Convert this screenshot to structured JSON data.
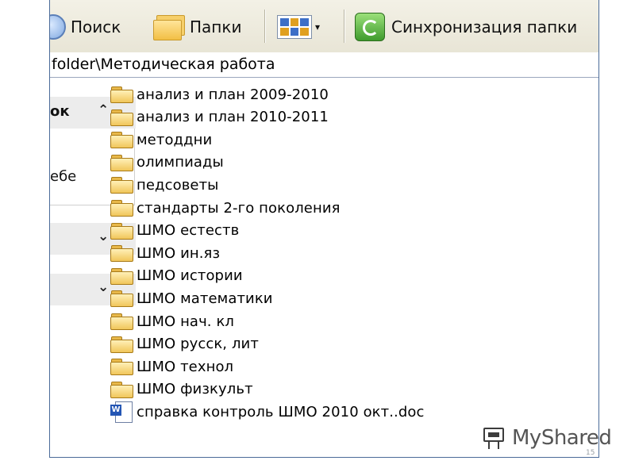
{
  "toolbar": {
    "search_label": "Поиск",
    "folders_label": "Папки",
    "sync_label": "Синхронизация папки",
    "views_arrow": "▾"
  },
  "address": {
    "path": "folder\\Методическая работа"
  },
  "taskpane": {
    "section1": {
      "title": "ок",
      "chevron": "⌃",
      "link": "ебе"
    },
    "section2": {
      "chevron": "⌄"
    },
    "section3": {
      "chevron": "⌄"
    }
  },
  "files": [
    {
      "name": "анализ и план 2009-2010",
      "type": "folder"
    },
    {
      "name": "анализ и план 2010-2011",
      "type": "folder"
    },
    {
      "name": "методдни",
      "type": "folder"
    },
    {
      "name": "олимпиады",
      "type": "folder"
    },
    {
      "name": "педсоветы",
      "type": "folder"
    },
    {
      "name": "стандарты 2-го поколения",
      "type": "folder"
    },
    {
      "name": "ШМО естеств",
      "type": "folder"
    },
    {
      "name": "ШМО ин.яз",
      "type": "folder"
    },
    {
      "name": "ШМО истории",
      "type": "folder"
    },
    {
      "name": "ШМО математики",
      "type": "folder"
    },
    {
      "name": "ШМО нач. кл",
      "type": "folder"
    },
    {
      "name": "ШМО русск, лит",
      "type": "folder"
    },
    {
      "name": "ШМО технол",
      "type": "folder"
    },
    {
      "name": "ШМО физкульт",
      "type": "folder"
    },
    {
      "name": "справка контроль ШМО 2010 окт..doc",
      "type": "word-document"
    }
  ],
  "watermark": {
    "text": "MyShared"
  },
  "slide": {
    "page_number": "15"
  },
  "colors": {
    "frame_border": "#4b6b99",
    "toolbar_bg": "#ece9d8",
    "pane_header": "#ececec"
  }
}
